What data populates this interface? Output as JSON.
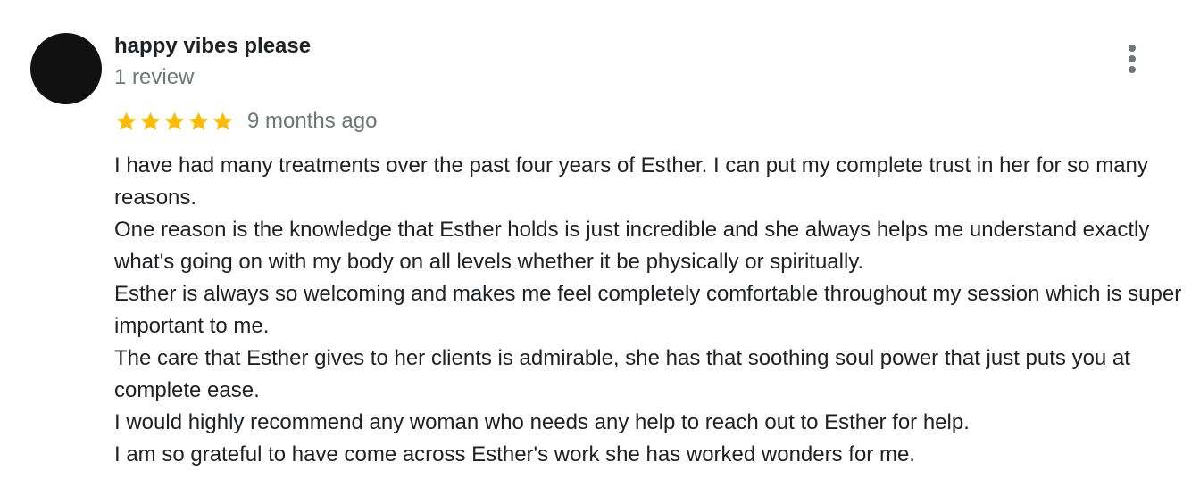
{
  "review": {
    "author_name": "happy vibes please",
    "review_count": "1 review",
    "rating": 5,
    "rating_max": 5,
    "date": "9 months ago",
    "more_icon": "more-vert-icon",
    "star_icon": "star-icon",
    "star_color": "#fbbc04",
    "avatar_color": "#111111",
    "paragraphs": [
      "I have had many treatments over the past four years of Esther. I can put my complete trust in her for so many reasons.",
      "One reason is the knowledge that Esther holds is just incredible and she always helps me understand exactly what's going on with my body on all levels whether it be physically or spiritually.",
      "Esther is always so welcoming and makes me feel completely comfortable throughout my session which is super important to me.",
      "The care that Esther gives to her clients is admirable, she has that soothing soul power that just puts you at complete ease.",
      "I would highly recommend any woman who needs any help to reach out to Esther for help.",
      "I am so grateful to have come across Esther's work she has worked wonders for me."
    ]
  }
}
